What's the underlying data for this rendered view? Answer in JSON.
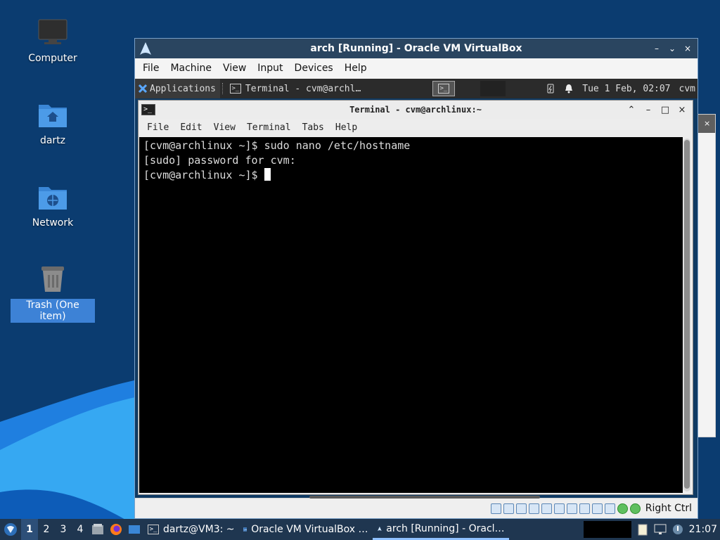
{
  "desktop": {
    "icons": [
      {
        "label": "Computer",
        "icon": "computer-icon"
      },
      {
        "label": "dartz",
        "icon": "home-folder-icon"
      },
      {
        "label": "Network",
        "icon": "network-folder-icon"
      },
      {
        "label": "Trash (One item)",
        "icon": "trash-icon"
      }
    ]
  },
  "vbox": {
    "title": "arch [Running] - Oracle VM VirtualBox",
    "window_buttons": [
      "–",
      "⌄",
      "×"
    ],
    "menu": [
      "File",
      "Machine",
      "View",
      "Input",
      "Devices",
      "Help"
    ],
    "status": {
      "host_key": "Right Ctrl"
    }
  },
  "guest": {
    "panel": {
      "applications": "Applications",
      "task_label": "Terminal - cvm@archl…",
      "clock": "Tue   1 Feb, 02:07",
      "user": "cvm"
    },
    "terminal": {
      "title": "Terminal - cvm@archlinux:~",
      "menu": [
        "File",
        "Edit",
        "View",
        "Terminal",
        "Tabs",
        "Help"
      ],
      "lines": [
        "[cvm@archlinux ~]$ sudo nano /etc/hostname",
        "[sudo] password for cvm:",
        "[cvm@archlinux ~]$ "
      ]
    }
  },
  "taskbar": {
    "workspaces": [
      "1",
      "2",
      "3",
      "4"
    ],
    "active_workspace": "1",
    "tasks": [
      {
        "label": "dartz@VM3: ~",
        "icon": "terminal-icon"
      },
      {
        "label": "Oracle VM VirtualBox …",
        "icon": "virtualbox-icon"
      },
      {
        "label": "arch [Running] - Oracl…",
        "icon": "virtualbox-icon"
      }
    ],
    "clock": "21:07"
  },
  "colors": {
    "desktop_bg": "#0b3c70",
    "vbox_titlebar": "#2a4560",
    "taskbar": "#1f3650",
    "selection": "#3d82d6"
  }
}
